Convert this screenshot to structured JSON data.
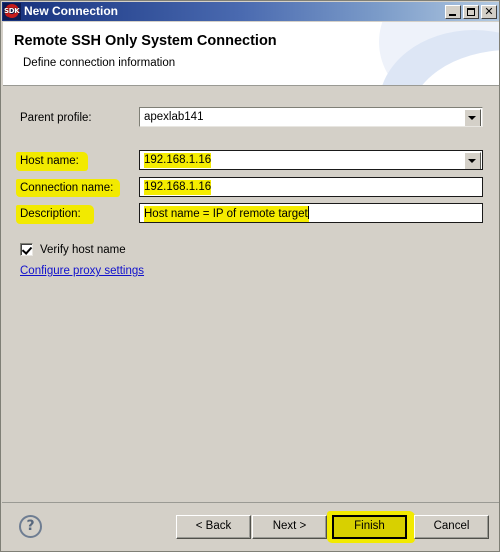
{
  "window": {
    "title": "New Connection",
    "icon": "sdk-gear-icon",
    "controls": {
      "minimize": "minimize-icon",
      "maximize": "maximize-icon",
      "close": "close-icon"
    }
  },
  "header": {
    "title": "Remote SSH Only System Connection",
    "subtitle": "Define connection information"
  },
  "form": {
    "parent_profile": {
      "label": "Parent profile:",
      "value": "apexlab141",
      "type": "combobox",
      "highlighted_label": false,
      "highlighted_value": false
    },
    "host_name": {
      "label": "Host name:",
      "value": "192.168.1.16",
      "type": "combobox",
      "highlighted_label": true,
      "highlighted_value": true
    },
    "connection_name": {
      "label": "Connection name:",
      "value": "192.168.1.16",
      "type": "text",
      "highlighted_label": true,
      "highlighted_value": true
    },
    "description": {
      "label": "Description:",
      "value": "Host name = IP of remote target",
      "type": "text",
      "highlighted_label": true,
      "highlighted_value": true,
      "has_caret": true
    },
    "verify_host_name": {
      "label": "Verify host name",
      "checked": true
    },
    "proxy_link": {
      "label": "Configure proxy settings"
    }
  },
  "footer": {
    "help": "?",
    "buttons": [
      {
        "label": "< Back",
        "name": "back-button",
        "highlighted": false
      },
      {
        "label": "Next >",
        "name": "next-button",
        "highlighted": false
      },
      {
        "label": "Finish",
        "name": "finish-button",
        "highlighted": true
      },
      {
        "label": "Cancel",
        "name": "cancel-button",
        "highlighted": false
      }
    ]
  },
  "colors": {
    "dialog_background": "#d4d0c8",
    "titlebar_start": "#16307a",
    "titlebar_end": "#b3cae2",
    "highlighter_yellow": "#f2ea00",
    "finish_button_fill": "#d8d000",
    "link_blue": "#1111cc"
  }
}
